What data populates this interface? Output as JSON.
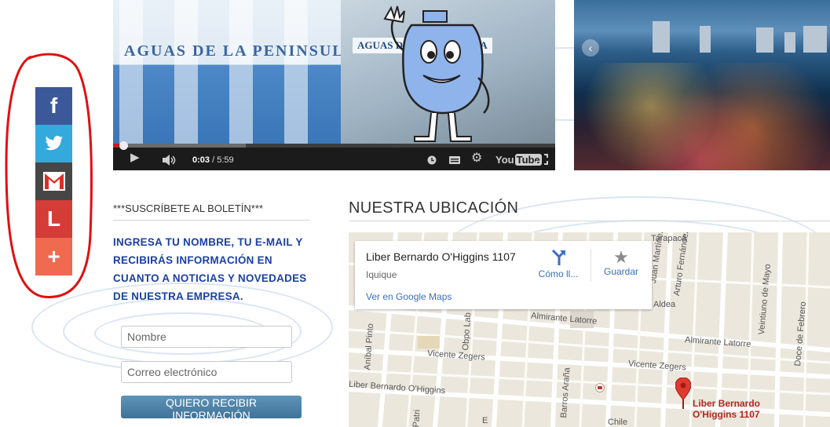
{
  "share_bar": {
    "buttons": [
      {
        "name": "facebook",
        "glyph": "f",
        "color": "#3b5998"
      },
      {
        "name": "twitter",
        "glyph": "twitter-bird",
        "color": "#33a9dd"
      },
      {
        "name": "gmail",
        "glyph": "M",
        "color": "#464646"
      },
      {
        "name": "l",
        "glyph": "L",
        "color": "#d43d37"
      },
      {
        "name": "more",
        "glyph": "+",
        "color": "#f06a4f"
      }
    ],
    "highlight_color": "#e01010"
  },
  "video": {
    "sign_text": "AGUAS DE LA PENINSULA",
    "sign_text_2": "AGUAS DE LA PENINSULA",
    "time_current": "0:03",
    "time_total": "5:59",
    "progress_fraction": 0.01,
    "buffered_fraction": 0.3,
    "youtube_label": "You",
    "youtube_label_tube": "Tube"
  },
  "newsletter": {
    "title": "***SUSCRÍBETE AL BOLETÍN***",
    "text": "INGRESA TU NOMBRE, TU E-MAIL Y RECIBIRÁS INFORMACIÓN EN CUANTO A NOTICIAS Y NOVEDADES DE NUESTRA EMPRESA.",
    "name_placeholder": "Nombre",
    "email_placeholder": "Correo electrónico",
    "button_label": "QUIERO RECIBIR INFORMACIÓN"
  },
  "location": {
    "title": "NUESTRA UBICACIÓN",
    "card_title": "Liber Bernardo O'Higgins 1107",
    "card_subtitle": "Iquique",
    "card_link": "Ver en Google Maps",
    "directions_label": "Cómo ll...",
    "save_label": "Guardar",
    "pin_label_line1": "Liber Bernardo",
    "pin_label_line2": "O'Higgins 1107",
    "streets": {
      "tarapaca": "Tarapacá",
      "arturo_fernandez": "Arturo Fernández",
      "juan_martinez": "Juan Martínez",
      "veintiuno_de_mayo": "Veintiuno de Mayo",
      "doce_de_febrero": "Doce de Febrero",
      "aldea": "Aldea",
      "almirante_latorre_1": "Almirante Latorre",
      "almirante_latorre_2": "Almirante Latorre",
      "vicente_zegers_1": "Vicente Zegers",
      "vicente_zegers_2": "Vicente Zegers",
      "liber_bernardo_ohiggins": "Liber Bernardo O'Higgins",
      "anibal_pinto": "Aníbal Pinto",
      "obispo_labbe": "Obpo Lab",
      "barros_arana": "Barros Araña",
      "patricio_lynch": "Patri",
      "chile": "Chile",
      "short_e": "E"
    }
  }
}
